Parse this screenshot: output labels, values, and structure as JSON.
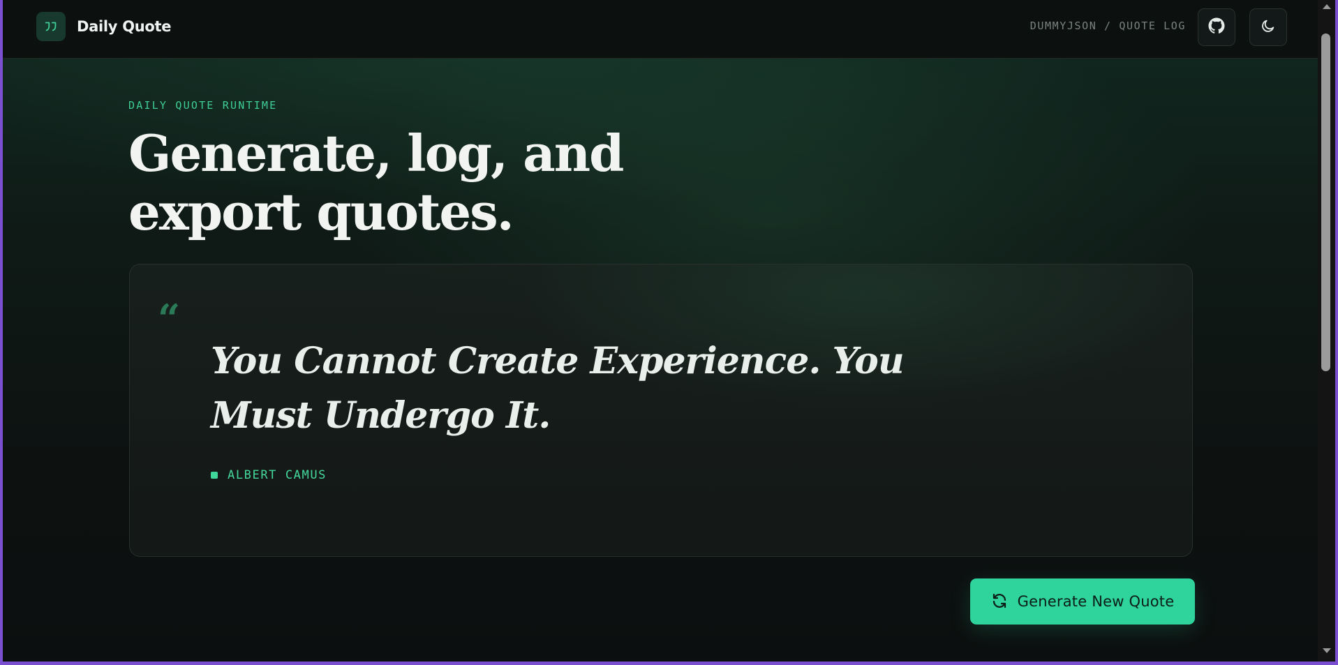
{
  "header": {
    "brand_name": "Daily Quote",
    "brand_icon": "quote-icon",
    "nav_link": "DUMMYJSON / QUOTE LOG",
    "github_icon": "github-icon",
    "theme_icon": "moon-icon"
  },
  "hero": {
    "eyebrow": "DAILY QUOTE RUNTIME",
    "headline_line1": "Generate, log, and",
    "headline_line2": "export quotes."
  },
  "quote": {
    "mark": "“",
    "text": "You Cannot Create Experience. You Must Undergo It.",
    "author": "ALBERT CAMUS"
  },
  "actions": {
    "generate_label": "Generate New Quote",
    "generate_icon": "refresh-icon"
  },
  "colors": {
    "accent": "#2fd49d",
    "accent_text": "#3fce96",
    "background": "#0d1211",
    "browser_border": "#7a4fd0"
  }
}
